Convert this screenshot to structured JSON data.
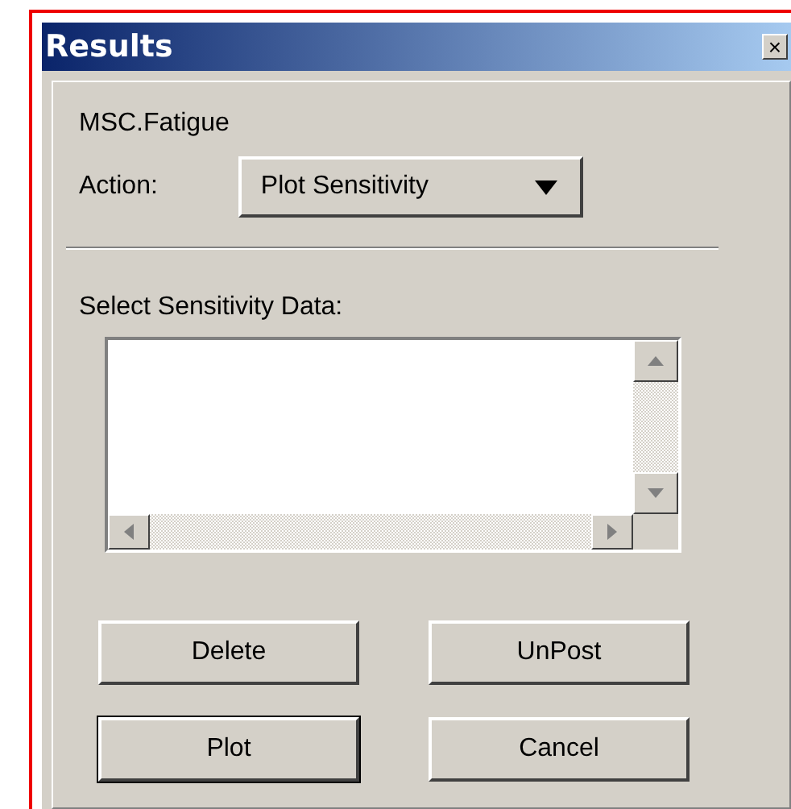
{
  "window": {
    "title": "Results",
    "close": "×"
  },
  "app_label": "MSC.Fatigue",
  "action": {
    "label": "Action:",
    "value": "Plot Sensitivity"
  },
  "list_label": "Select Sensitivity Data:",
  "buttons": [
    {
      "label": "Delete",
      "default": false
    },
    {
      "label": "UnPost",
      "default": false
    },
    {
      "label": "Plot",
      "default": true
    },
    {
      "label": "Cancel",
      "default": false
    }
  ]
}
